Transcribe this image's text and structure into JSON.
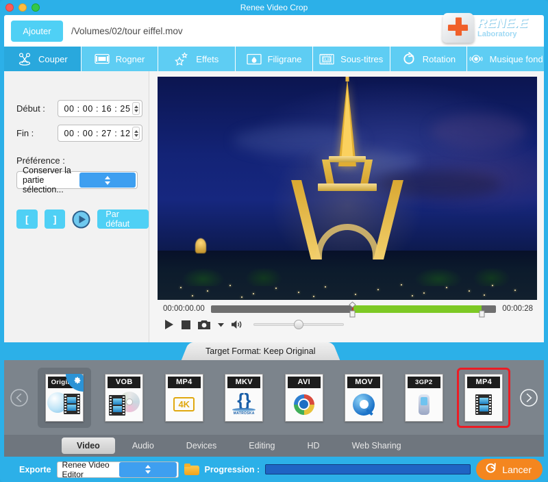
{
  "window": {
    "title": "Renee Video Crop",
    "controls": [
      "close",
      "minimize",
      "zoom"
    ]
  },
  "pathbar": {
    "add_label": "Ajouter",
    "file_path": "/Volumes/02/tour eiffel.mov",
    "logo_main": "RENE.E",
    "logo_sub": "Laboratory"
  },
  "tabs": [
    {
      "label": "Couper",
      "icon": "scissors-icon",
      "active": true
    },
    {
      "label": "Rogner",
      "icon": "crop-icon",
      "active": false
    },
    {
      "label": "Effets",
      "icon": "sparkle-icon",
      "active": false
    },
    {
      "label": "Filigrane",
      "icon": "watermark-icon",
      "active": false
    },
    {
      "label": "Sous-titres",
      "icon": "subtitle-icon",
      "active": false
    },
    {
      "label": "Rotation",
      "icon": "rotate-icon",
      "active": false
    },
    {
      "label": "Musique fond",
      "icon": "audio-icon",
      "active": false
    }
  ],
  "trim_panel": {
    "start_label": "Début :",
    "start_value": "00 : 00  : 16  : 25",
    "end_label": "Fin :",
    "end_value": "00 : 00  : 27  : 12",
    "preference_label": "Préférence :",
    "preference_value": "Conserver la partie sélection...",
    "mark_in": "[",
    "mark_out": "]",
    "default_label": "Par défaut"
  },
  "player": {
    "current_time": "00:00:00.00",
    "duration": "00:00:28",
    "selection_start_pct": 49.5,
    "selection_end_pct": 95,
    "volume_pct": 50,
    "buttons": [
      "play-icon",
      "stop-icon",
      "snapshot-icon",
      "snapshot-menu-icon",
      "volume-icon"
    ]
  },
  "format_panel": {
    "tab_label": "Target Format: Keep Original",
    "prev_arrow": "chevron-left-icon",
    "next_arrow": "chevron-right-icon",
    "items": [
      {
        "label": "Original",
        "art": "globe-film",
        "state": "current",
        "badge": "gear-icon"
      },
      {
        "label": "VOB",
        "art": "disc-film",
        "state": "normal",
        "badge": ""
      },
      {
        "label": "MP4",
        "art": "badge-4k",
        "state": "normal",
        "badge": ""
      },
      {
        "label": "MKV",
        "art": "matroska",
        "state": "normal",
        "badge": ""
      },
      {
        "label": "AVI",
        "art": "color-ring",
        "state": "normal",
        "badge": ""
      },
      {
        "label": "MOV",
        "art": "quicktime",
        "state": "normal",
        "badge": ""
      },
      {
        "label": "3GP2",
        "art": "phone",
        "state": "normal",
        "badge": ""
      },
      {
        "label": "MP4",
        "art": "film",
        "state": "selected",
        "badge": ""
      }
    ],
    "matroska_caption": "MATROSKA"
  },
  "categories": [
    {
      "label": "Video",
      "active": true
    },
    {
      "label": "Audio",
      "active": false
    },
    {
      "label": "Devices",
      "active": false
    },
    {
      "label": "Editing",
      "active": false
    },
    {
      "label": "HD",
      "active": false
    },
    {
      "label": "Web Sharing",
      "active": false
    }
  ],
  "export_bar": {
    "export_label": "Exporte",
    "export_value": "Renee Video Editor",
    "folder_icon": "folder-icon",
    "progress_label": "Progression :",
    "progress_pct": 0,
    "start_label": "Lancer",
    "start_icon": "refresh-icon"
  },
  "colors": {
    "brand_blue": "#2cb0e8",
    "tab_blue": "#5ecdf3",
    "active_tab_blue": "#29a8dd",
    "button_cyan": "#4fd0f5",
    "selection_green": "#7dc924",
    "selected_red": "#ec1c24",
    "accent_orange": "#f4861f",
    "panel_gray": "#7c848c"
  }
}
